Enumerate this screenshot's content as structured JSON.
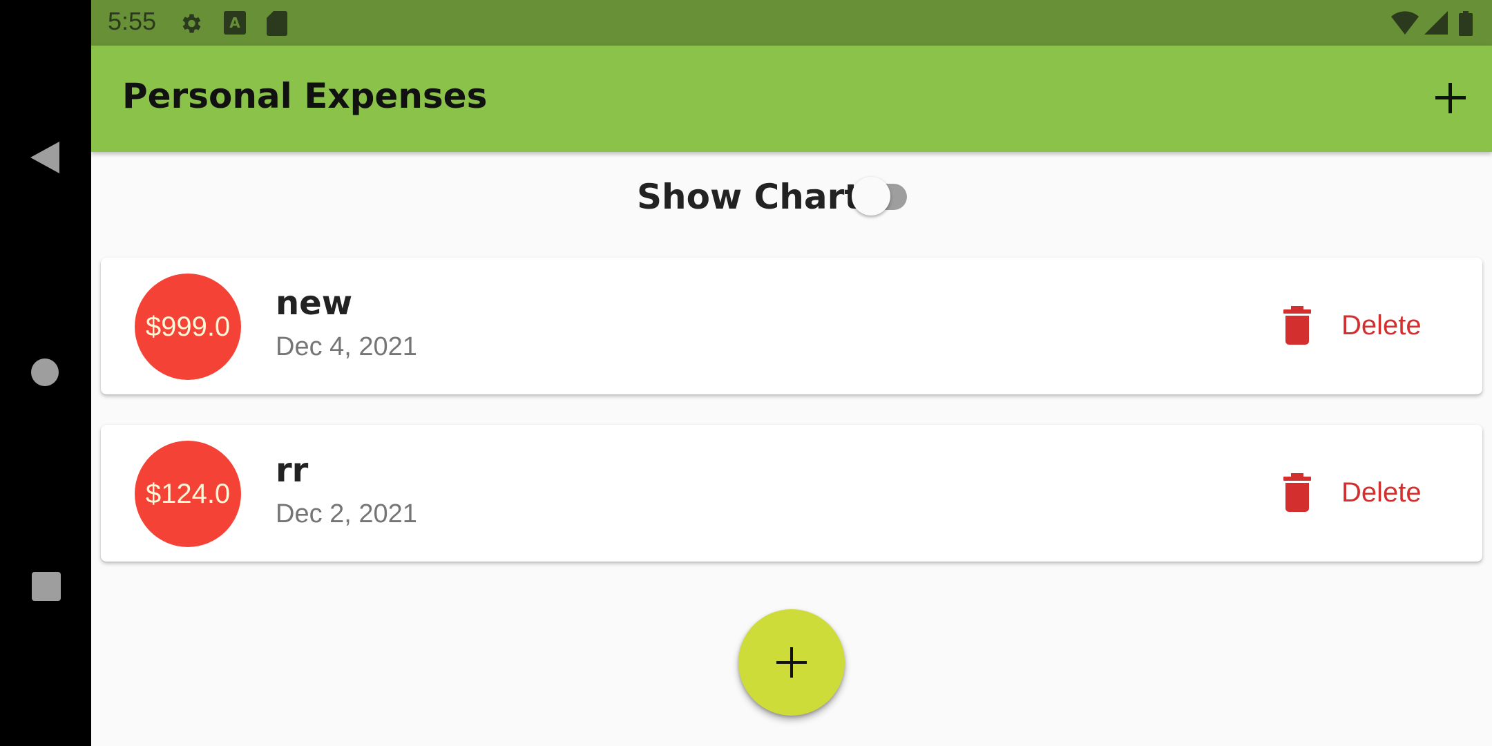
{
  "status_bar": {
    "time": "5:55",
    "icons": [
      "gear-icon",
      "keyboard-a-icon",
      "sd-card-icon",
      "wifi-icon",
      "cell-signal-icon",
      "battery-icon"
    ]
  },
  "nav_bar": {
    "buttons": [
      "back-icon",
      "home-icon",
      "recents-icon"
    ]
  },
  "app_bar": {
    "title": "Personal Expenses",
    "action_icon": "plus-icon"
  },
  "chart_toggle": {
    "label": "Show Chart",
    "checked": false
  },
  "transactions": [
    {
      "amount": "$999.0",
      "title": "new",
      "date": "Dec 4, 2021",
      "delete_label": "Delete"
    },
    {
      "amount": "$124.0",
      "title": "rr",
      "date": "Dec 2, 2021",
      "delete_label": "Delete"
    }
  ],
  "fab": {
    "icon": "plus-icon"
  },
  "colors": {
    "primary": "#8bc34a",
    "primary_dark": "#689036",
    "accent": "#cddc39",
    "amount_circle": "#f44336",
    "delete": "#d32f2f"
  }
}
